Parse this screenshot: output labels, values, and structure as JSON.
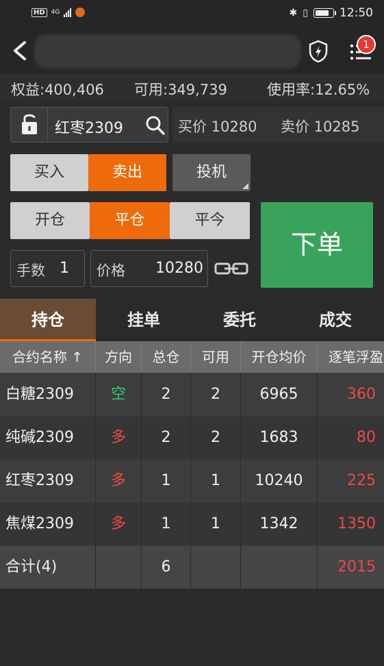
{
  "status_bar": {
    "network": "4G",
    "time": "12:50",
    "battery_level": 0.8,
    "icons": [
      "hd-icon",
      "signal-icon",
      "app-notification-icon",
      "bluetooth-icon",
      "vibrate-icon",
      "battery-icon"
    ]
  },
  "header": {
    "badge_count": "1",
    "icons": [
      "back-arrow-icon",
      "shield-lightning-icon",
      "menu-list-icon"
    ]
  },
  "account": {
    "equity": "权益:400,406",
    "available": "可用:349,739",
    "usage": "使用率:12.65%"
  },
  "order": {
    "contract": "红枣2309",
    "bid": "买价 10280",
    "ask": "卖价 10285",
    "buy_label": "买入",
    "sell_label": "卖出",
    "speculation_label": "投机",
    "open_label": "开仓",
    "close_label": "平仓",
    "close_today_label": "平今",
    "submit_label": "下单",
    "qty_label": "手数",
    "qty_value": "1",
    "price_label": "价格",
    "price_value": "10280",
    "selected_side": "卖出",
    "selected_offset": "平仓",
    "accent_color": "#ee6a0b",
    "submit_color": "#39a35c"
  },
  "tabs": [
    {
      "label": "持仓",
      "active": true
    },
    {
      "label": "挂单",
      "active": false
    },
    {
      "label": "委托",
      "active": false
    },
    {
      "label": "成交",
      "active": false
    }
  ],
  "positions": {
    "headers": [
      "合约名称 ↑",
      "方向",
      "总仓",
      "可用",
      "开仓均价",
      "逐笔浮盈"
    ],
    "rows": [
      {
        "name": "白糖2309",
        "direction": "空",
        "total": "2",
        "available": "2",
        "avg_price": "6965",
        "pnl": "360"
      },
      {
        "name": "纯碱2309",
        "direction": "多",
        "total": "2",
        "available": "2",
        "avg_price": "1683",
        "pnl": "80"
      },
      {
        "name": "红枣2309",
        "direction": "多",
        "total": "1",
        "available": "1",
        "avg_price": "10240",
        "pnl": "225"
      },
      {
        "name": "焦煤2309",
        "direction": "多",
        "total": "1",
        "available": "1",
        "avg_price": "1342",
        "pnl": "1350"
      }
    ],
    "total": {
      "label": "合计(4)",
      "direction": "",
      "total": "6",
      "available": "",
      "avg_price": "",
      "pnl": "2015"
    },
    "colors": {
      "short": "#2ecc71",
      "long": "#f04848",
      "profit": "#f04848"
    }
  }
}
